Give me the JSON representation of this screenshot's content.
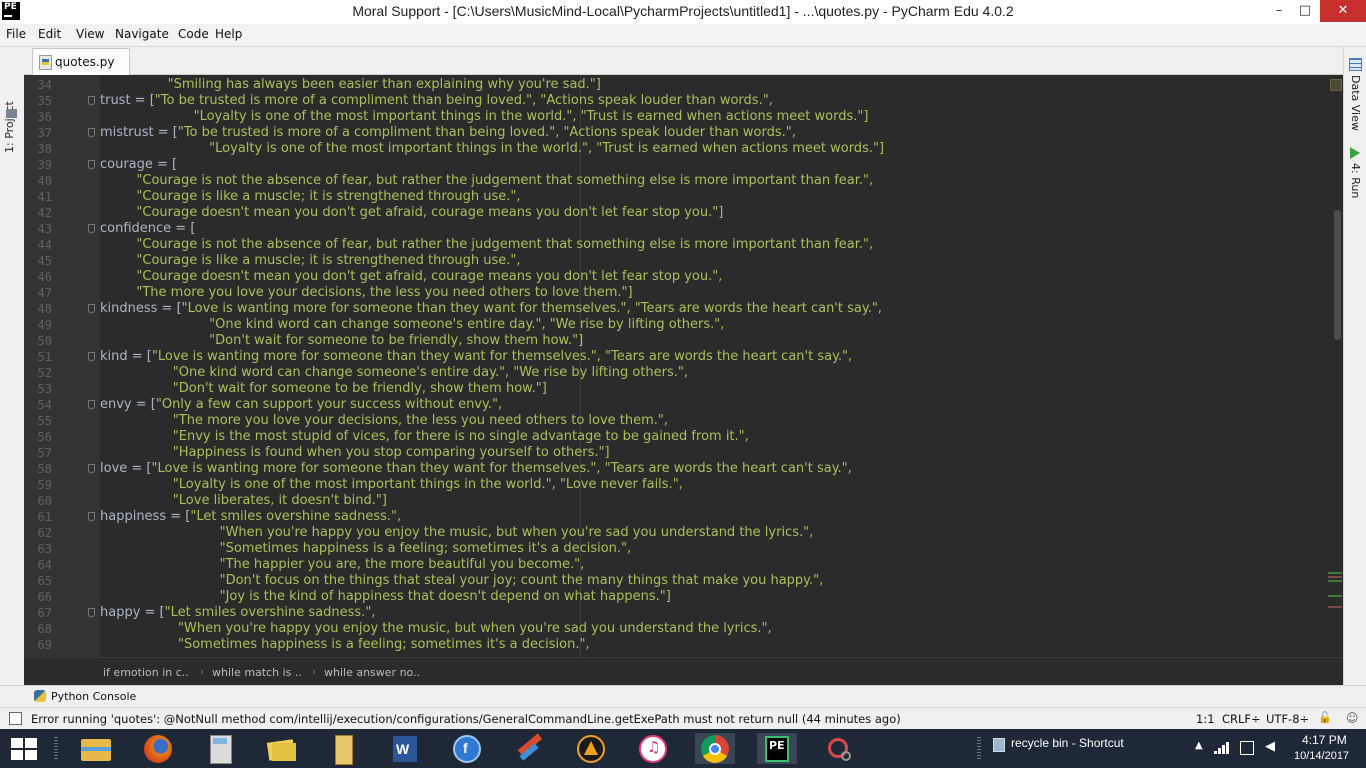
{
  "window": {
    "title": "Moral Support - [C:\\Users\\MusicMind-Local\\PycharmProjects\\untitled1] - ...\\quotes.py - PyCharm Edu 4.0.2",
    "app_logo": "PE",
    "minimize": "–",
    "maximize": "□",
    "close": "✕"
  },
  "menu": [
    "File",
    "Edit",
    "View",
    "Navigate",
    "Code",
    "Help"
  ],
  "left_tools": {
    "project": "1: Project"
  },
  "right_tools": {
    "data_view": "Data View",
    "run": "4: Run"
  },
  "tabs": [
    {
      "label": "quotes.py",
      "close": "×"
    }
  ],
  "editor": {
    "lines": [
      {
        "n": "34",
        "indent": 13,
        "parts": [
          [
            "str",
            "\"Smiling has always been easier than explaining why you're sad.\"]"
          ]
        ]
      },
      {
        "n": "35",
        "indent": 0,
        "fold": true,
        "parts": [
          [
            "ident",
            "trust = ["
          ],
          [
            "str",
            "\"To be trusted is more of a compliment than being loved.\", \"Actions speak louder than words.\","
          ]
        ]
      },
      {
        "n": "36",
        "indent": 18,
        "parts": [
          [
            "str",
            "\"Loyalty is one of the most important things in the world.\", \"Trust is earned when actions meet words.\"]"
          ]
        ]
      },
      {
        "n": "37",
        "indent": 0,
        "fold": true,
        "parts": [
          [
            "ident",
            "mistrust = ["
          ],
          [
            "str",
            "\"To be trusted is more of a compliment than being loved.\", \"Actions speak louder than words.\","
          ]
        ]
      },
      {
        "n": "38",
        "indent": 21,
        "parts": [
          [
            "str",
            "\"Loyalty is one of the most important things in the world.\", \"Trust is earned when actions meet words.\"]"
          ]
        ]
      },
      {
        "n": "39",
        "indent": 0,
        "fold": true,
        "parts": [
          [
            "ident",
            "courage = ["
          ]
        ]
      },
      {
        "n": "40",
        "indent": 7,
        "parts": [
          [
            "str",
            "\"Courage is not the absence of fear, but rather the judgement that something else is more important than fear.\","
          ]
        ]
      },
      {
        "n": "41",
        "indent": 7,
        "parts": [
          [
            "str",
            "\"Courage is like a muscle; it is strengthened through use.\","
          ]
        ]
      },
      {
        "n": "42",
        "indent": 7,
        "parts": [
          [
            "str",
            "\"Courage doesn't mean you don't get afraid, courage means you don't let fear stop you.\"]"
          ]
        ]
      },
      {
        "n": "43",
        "indent": 0,
        "fold": true,
        "parts": [
          [
            "ident",
            "confidence = ["
          ]
        ]
      },
      {
        "n": "44",
        "indent": 7,
        "parts": [
          [
            "str",
            "\"Courage is not the absence of fear, but rather the judgement that something else is more important than fear.\","
          ]
        ]
      },
      {
        "n": "45",
        "indent": 7,
        "parts": [
          [
            "str",
            "\"Courage is like a muscle; it is strengthened through use.\","
          ]
        ]
      },
      {
        "n": "46",
        "indent": 7,
        "parts": [
          [
            "str",
            "\"Courage doesn't mean you don't get afraid, courage means you don't let fear stop you.\","
          ]
        ]
      },
      {
        "n": "47",
        "indent": 7,
        "parts": [
          [
            "str",
            "\"The more you love your decisions, the less you need others to love them.\"]"
          ]
        ]
      },
      {
        "n": "48",
        "indent": 0,
        "fold": true,
        "parts": [
          [
            "ident",
            "kindness = ["
          ],
          [
            "str",
            "\"Love is wanting more for someone than they want for themselves.\", \"Tears are words the heart can't say.\","
          ]
        ]
      },
      {
        "n": "49",
        "indent": 21,
        "parts": [
          [
            "str",
            "\"One kind word can change someone's entire day.\", \"We rise by lifting others.\","
          ]
        ]
      },
      {
        "n": "50",
        "indent": 21,
        "parts": [
          [
            "str",
            "\"Don't wait for someone to be friendly, show them how.\"]"
          ]
        ]
      },
      {
        "n": "51",
        "indent": 0,
        "fold": true,
        "parts": [
          [
            "ident",
            "kind = ["
          ],
          [
            "str",
            "\"Love is wanting more for someone than they want for themselves.\", \"Tears are words the heart can't say.\","
          ]
        ]
      },
      {
        "n": "52",
        "indent": 14,
        "parts": [
          [
            "str",
            "\"One kind word can change someone's entire day.\", \"We rise by lifting others.\","
          ]
        ]
      },
      {
        "n": "53",
        "indent": 14,
        "parts": [
          [
            "str",
            "\"Don't wait for someone to be friendly, show them how.\"]"
          ]
        ]
      },
      {
        "n": "54",
        "indent": 0,
        "fold": true,
        "parts": [
          [
            "ident",
            "envy = ["
          ],
          [
            "str",
            "\"Only a few can support your success without envy.\","
          ]
        ]
      },
      {
        "n": "55",
        "indent": 14,
        "parts": [
          [
            "str",
            "\"The more you love your decisions, the less you need others to love them.\","
          ]
        ]
      },
      {
        "n": "56",
        "indent": 14,
        "parts": [
          [
            "str",
            "\"Envy is the most stupid of vices, for there is no single advantage to be gained from it.\","
          ]
        ]
      },
      {
        "n": "57",
        "indent": 14,
        "parts": [
          [
            "str",
            "\"Happiness is found when you stop comparing yourself to others.\"]"
          ]
        ]
      },
      {
        "n": "58",
        "indent": 0,
        "fold": true,
        "parts": [
          [
            "ident",
            "love = ["
          ],
          [
            "str",
            "\"Love is wanting more for someone than they want for themselves.\", \"Tears are words the heart can't say.\","
          ]
        ]
      },
      {
        "n": "59",
        "indent": 14,
        "parts": [
          [
            "str",
            "\"Loyalty is one of the most important things in the world.\", \"Love never fails.\","
          ]
        ]
      },
      {
        "n": "60",
        "indent": 14,
        "parts": [
          [
            "str",
            "\"Love liberates, it doesn't bind.\"]"
          ]
        ]
      },
      {
        "n": "61",
        "indent": 0,
        "fold": true,
        "parts": [
          [
            "ident",
            "happiness = ["
          ],
          [
            "str",
            "\"Let smiles overshine sadness.\","
          ]
        ]
      },
      {
        "n": "62",
        "indent": 23,
        "parts": [
          [
            "str",
            "\"When you're happy you enjoy the music, but when you're sad you understand the lyrics.\","
          ]
        ]
      },
      {
        "n": "63",
        "indent": 23,
        "parts": [
          [
            "str",
            "\"Sometimes happiness is a feeling; sometimes it's a decision.\","
          ]
        ]
      },
      {
        "n": "64",
        "indent": 23,
        "parts": [
          [
            "str",
            "\"The happier you are, the more beautiful you become.\","
          ]
        ]
      },
      {
        "n": "65",
        "indent": 23,
        "parts": [
          [
            "str",
            "\"Don't focus on the things that steal your joy; count the many things that make you happy.\","
          ]
        ]
      },
      {
        "n": "66",
        "indent": 23,
        "parts": [
          [
            "str",
            "\"Joy is the kind of happiness that doesn't depend on what happens.\"]"
          ]
        ]
      },
      {
        "n": "67",
        "indent": 0,
        "fold": true,
        "parts": [
          [
            "ident",
            "happy = ["
          ],
          [
            "str",
            "\"Let smiles overshine sadness.\","
          ]
        ]
      },
      {
        "n": "68",
        "indent": 15,
        "parts": [
          [
            "str",
            "\"When you're happy you enjoy the music, but when you're sad you understand the lyrics.\","
          ]
        ]
      },
      {
        "n": "69",
        "indent": 15,
        "parts": [
          [
            "str",
            "\"Sometimes happiness is a feeling; sometimes it's a decision.\","
          ]
        ]
      }
    ]
  },
  "breadcrumb": [
    "if emotion in c..",
    "while match is ..",
    "while answer no.."
  ],
  "toolwindows": {
    "python_console": "Python Console"
  },
  "status": {
    "message": "Error running 'quotes': @NotNull method com/intellij/execution/configurations/GeneralCommandLine.getExePath must not return null (44 minutes ago)",
    "position": "1:1",
    "line_sep": "CRLF÷",
    "encoding": "UTF-8÷"
  },
  "taskbar": {
    "recycle_label": "recycle bin - Shortcut",
    "time": "4:17 PM",
    "date": "10/14/2017",
    "apps": [
      "file-explorer",
      "firefox",
      "calculator",
      "windows-explorer-folders",
      "folder",
      "word",
      "nightly-app",
      "paint",
      "vlc",
      "itunes",
      "chrome",
      "pycharm-edu",
      "snipping-tool"
    ]
  },
  "colors": {
    "string": "#a5c25c",
    "identifier": "#a9b7c6",
    "editor_bg": "#2b2b2b",
    "gutter_bg": "#313335"
  }
}
